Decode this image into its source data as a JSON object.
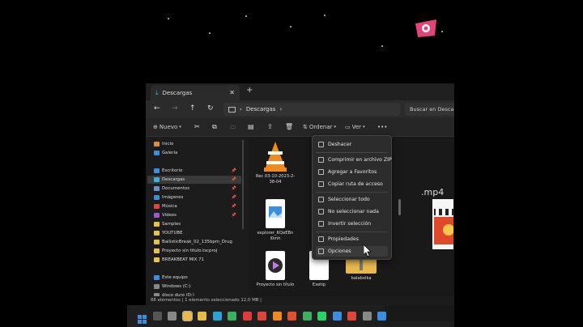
{
  "tab": {
    "title": "Descargas",
    "add": "+"
  },
  "address": {
    "crumb": "Descargas",
    "search_placeholder": "Buscar en Descargas"
  },
  "toolbar": {
    "new_label": "Nuevo",
    "sort_label": "Ordenar",
    "view_label": "Ver",
    "more_label": "•••"
  },
  "sidebar": [
    {
      "label": "Inicio",
      "color": "#e08a3a",
      "pinned": false
    },
    {
      "label": "Galería",
      "color": "#3b8de0",
      "pinned": false
    },
    {
      "label": "Escritorio",
      "color": "#3b8de0",
      "pinned": true
    },
    {
      "label": "Descargas",
      "color": "#3bb0e0",
      "pinned": true
    },
    {
      "label": "Documentos",
      "color": "#6c8fc9",
      "pinned": true
    },
    {
      "label": "Imágenes",
      "color": "#3b8de0",
      "pinned": true
    },
    {
      "label": "Música",
      "color": "#e0453b",
      "pinned": true
    },
    {
      "label": "Videos",
      "color": "#9b59d0",
      "pinned": true
    },
    {
      "label": "Samples",
      "color": "#e8c04a",
      "pinned": false
    },
    {
      "label": "YOUTUBE",
      "color": "#e8c04a",
      "pinned": false
    },
    {
      "label": "BallisticBreak_02_135bpm_Drug",
      "color": "#e8c04a",
      "pinned": false
    },
    {
      "label": "Proyecto sin título.tscproj",
      "color": "#e8c04a",
      "pinned": false
    },
    {
      "label": "BREAKBEAT MIX 71",
      "color": "#e8c04a",
      "pinned": false
    },
    {
      "label": "Este equipo",
      "color": "#3b8de0",
      "pinned": false
    },
    {
      "label": "Windows (C:)",
      "color": "#888888",
      "pinned": false
    },
    {
      "label": "disco duro (D:)",
      "color": "#888888",
      "pinned": false
    }
  ],
  "files": [
    {
      "name": "Rec 03-10-2023-2-38-04",
      "kind": "vlc"
    },
    {
      "name": "explorer_KQeEBn l0mh",
      "kind": "image"
    },
    {
      "name": "Proyecto sin título",
      "kind": "video"
    },
    {
      "name": "Exetip",
      "kind": "doc"
    },
    {
      "name": "balabolka",
      "kind": "zip"
    }
  ],
  "context_menu": {
    "items": [
      {
        "label": "Deshacer",
        "group": 0
      },
      {
        "label": "Comprimir en archivo ZIP",
        "group": 1
      },
      {
        "label": "Agregar a Favoritos",
        "group": 1
      },
      {
        "label": "Copiar ruta de acceso",
        "group": 1
      },
      {
        "label": "Seleccionar todo",
        "group": 2
      },
      {
        "label": "No seleccionar nada",
        "group": 2
      },
      {
        "label": "Invertir selección",
        "group": 2
      },
      {
        "label": "Propiedades",
        "group": 3
      },
      {
        "label": "Opciones",
        "group": 3
      }
    ]
  },
  "status": {
    "text": "88 elementos  |  1 elemento seleccionado  12,0 MB  |"
  },
  "side_label": ".mp4",
  "colors": {
    "accent": "#3b8de0",
    "window_bg": "#1c1c1c",
    "menu_bg": "#2c2c2c"
  }
}
